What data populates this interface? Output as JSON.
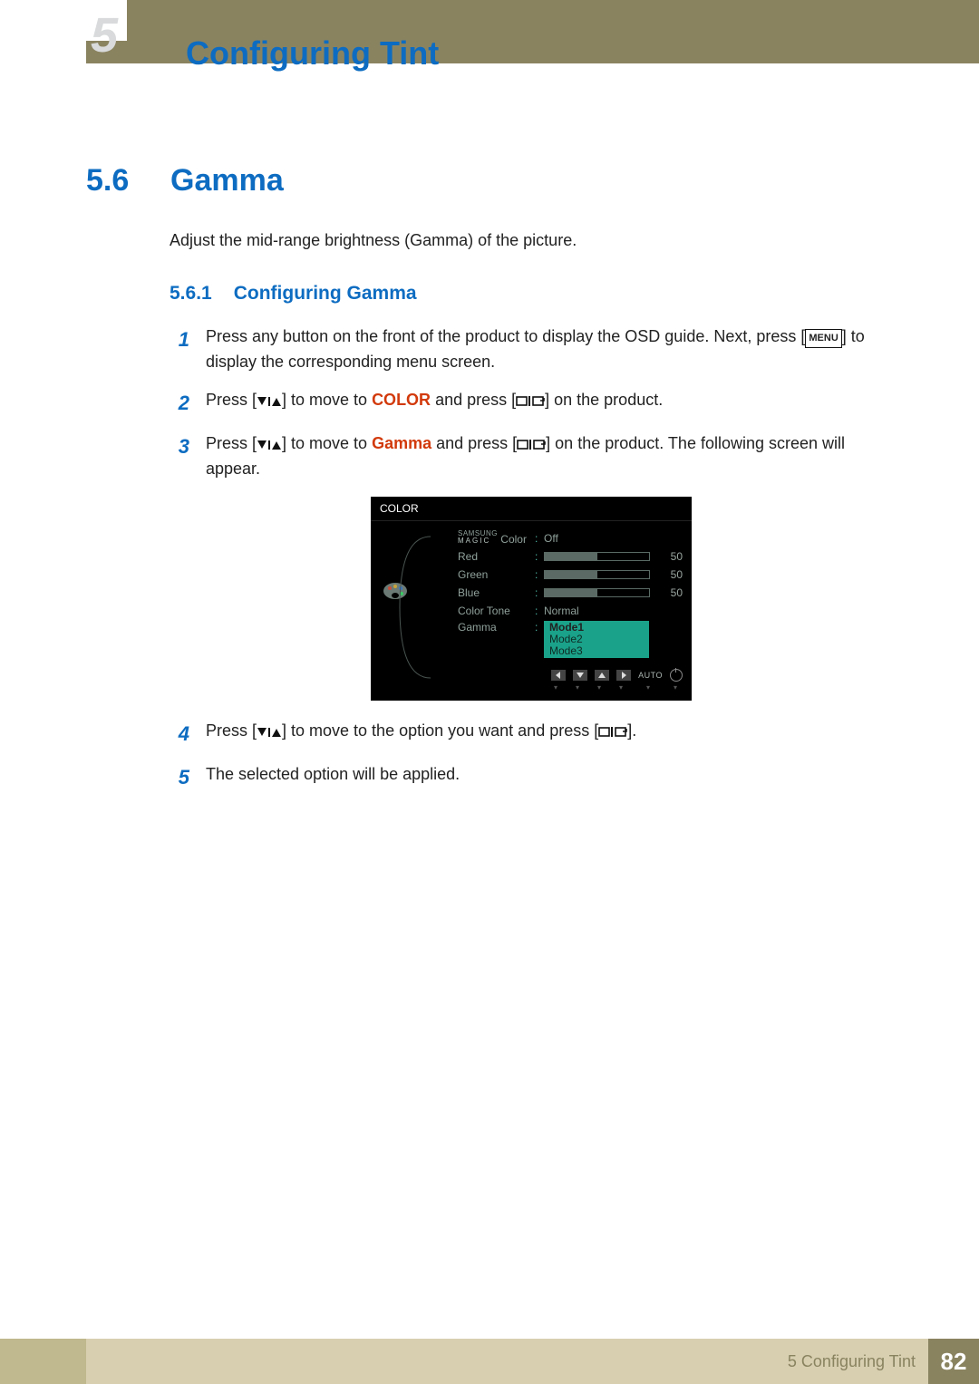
{
  "layout": {
    "chapter_big_number": "5",
    "page_title": "Configuring Tint"
  },
  "section": {
    "number": "5.6",
    "title": "Gamma",
    "intro": "Adjust the mid-range brightness (Gamma) of the picture."
  },
  "subsection": {
    "number": "5.6.1",
    "title": "Configuring Gamma"
  },
  "steps": {
    "s1_a": "Press any button on the front of the product to display the OSD guide. Next, press [",
    "s1_menu": "MENU",
    "s1_b": "] to display the corresponding menu screen.",
    "s2_a": "Press [",
    "s2_b": "] to move to ",
    "s2_color": "COLOR",
    "s2_c": " and press [",
    "s2_d": "] on the product.",
    "s3_a": "Press [",
    "s3_b": "] to move to ",
    "s3_gamma": "Gamma",
    "s3_c": " and press [",
    "s3_d": "] on the product. The following screen will appear.",
    "s4_a": "Press [",
    "s4_b": "] to move to the option you want and press [",
    "s4_c": "].",
    "s5": "The selected option will be applied."
  },
  "osd": {
    "panel_title": "COLOR",
    "brand_top": "SAMSUNG",
    "brand_bottom": "MAGIC",
    "items": {
      "magic_color": {
        "label": "Color",
        "value": "Off"
      },
      "red": {
        "label": "Red",
        "value": 50
      },
      "green": {
        "label": "Green",
        "value": 50
      },
      "blue": {
        "label": "Blue",
        "value": 50
      },
      "color_tone": {
        "label": "Color Tone",
        "value": "Normal"
      },
      "gamma": {
        "label": "Gamma",
        "options": [
          "Mode1",
          "Mode2",
          "Mode3"
        ],
        "selected": "Mode1"
      }
    },
    "footer_auto": "AUTO"
  },
  "footer": {
    "chapter_label": "5 Configuring Tint",
    "page_number": "82"
  }
}
